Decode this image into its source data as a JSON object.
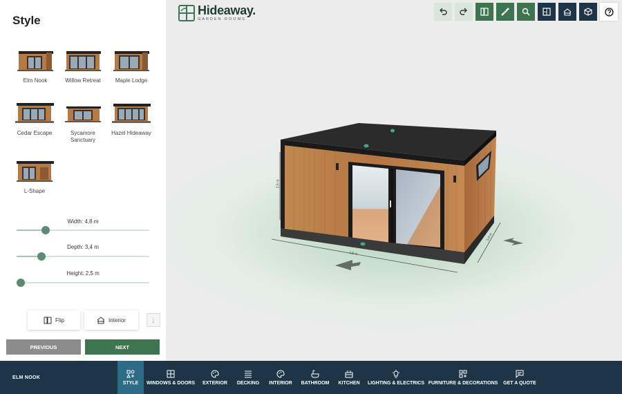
{
  "left_panel": {
    "title": "Style",
    "styles": [
      {
        "label": "Elm Nook"
      },
      {
        "label": "Willow Retreat"
      },
      {
        "label": "Maple Lodge"
      },
      {
        "label": "Cedar Escape"
      },
      {
        "label": "Sycamore Sanctuary"
      },
      {
        "label": "Hazel Hideaway"
      },
      {
        "label": "L-Shape"
      }
    ],
    "dimensions": {
      "width": {
        "label": "Width:  4,8  m",
        "value": 4.8,
        "fraction": 0.22
      },
      "depth": {
        "label": "Depth:  3,4  m",
        "value": 3.4,
        "fraction": 0.19
      },
      "height": {
        "label": "Height:  2,5  m",
        "value": 2.5,
        "fraction": 0.03
      }
    },
    "flip_label": "Flip",
    "interior_label": "Interior",
    "previous_label": "PREVIOUS",
    "next_label": "NEXT"
  },
  "viewport": {
    "logo_name": "Hideaway.",
    "logo_sub": "GARDEN ROOMS",
    "toolbar": [
      {
        "name": "undo-icon",
        "style": "light"
      },
      {
        "name": "redo-icon",
        "style": "light"
      },
      {
        "name": "mirror-icon",
        "style": "green"
      },
      {
        "name": "measure-icon",
        "style": "green"
      },
      {
        "name": "zoom-icon",
        "style": "green"
      },
      {
        "name": "floorplan-icon",
        "style": "navy"
      },
      {
        "name": "elevation-icon",
        "style": "navy"
      },
      {
        "name": "3d-view-icon",
        "style": "navy"
      },
      {
        "name": "help-icon",
        "style": "white"
      }
    ],
    "dim_labels": {
      "height": "2,5 m",
      "width": "4,8 m",
      "depth": "3,4 m"
    }
  },
  "bottom_nav": {
    "current_style": "ELM NOOK",
    "items": [
      {
        "label": "STYLE",
        "icon": "shapes-icon",
        "active": true
      },
      {
        "label": "WINDOWS & DOORS",
        "icon": "window-icon",
        "active": false
      },
      {
        "label": "EXTERIOR",
        "icon": "palette-icon",
        "active": false
      },
      {
        "label": "DECKING",
        "icon": "decking-icon",
        "active": false
      },
      {
        "label": "INTERIOR",
        "icon": "palette-icon",
        "active": false
      },
      {
        "label": "BATHROOM",
        "icon": "bath-icon",
        "active": false
      },
      {
        "label": "KITCHEN",
        "icon": "kitchen-icon",
        "active": false
      },
      {
        "label": "LIGHTING & ELECTRICS",
        "icon": "bulb-icon",
        "active": false
      },
      {
        "label": "FURNITURE & DECORATIONS",
        "icon": "furniture-icon",
        "active": false
      },
      {
        "label": "GET A QUOTE",
        "icon": "chat-icon",
        "active": false
      }
    ]
  },
  "colors": {
    "navy": "#1e3447",
    "green": "#3d7550",
    "active_tab": "#2d6b86",
    "slider_thumb": "#5c8b73",
    "timber": "#b77a45"
  }
}
